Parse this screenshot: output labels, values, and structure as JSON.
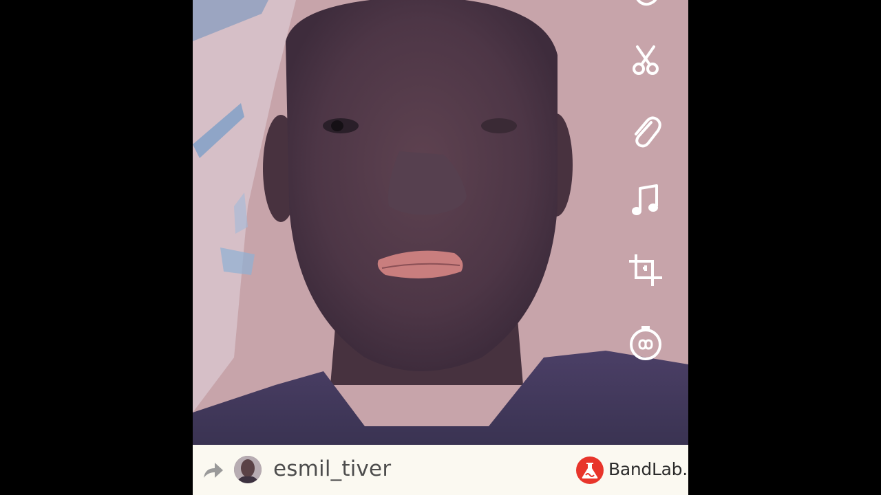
{
  "video": {
    "description_icons": [
      "scissors-icon",
      "paperclip-icon",
      "music-note-icon",
      "crop-icon",
      "timer-icon"
    ]
  },
  "footer": {
    "username": "esmil_tiver",
    "brand_name": "BandLab.",
    "brand_color": "#e8352b"
  }
}
